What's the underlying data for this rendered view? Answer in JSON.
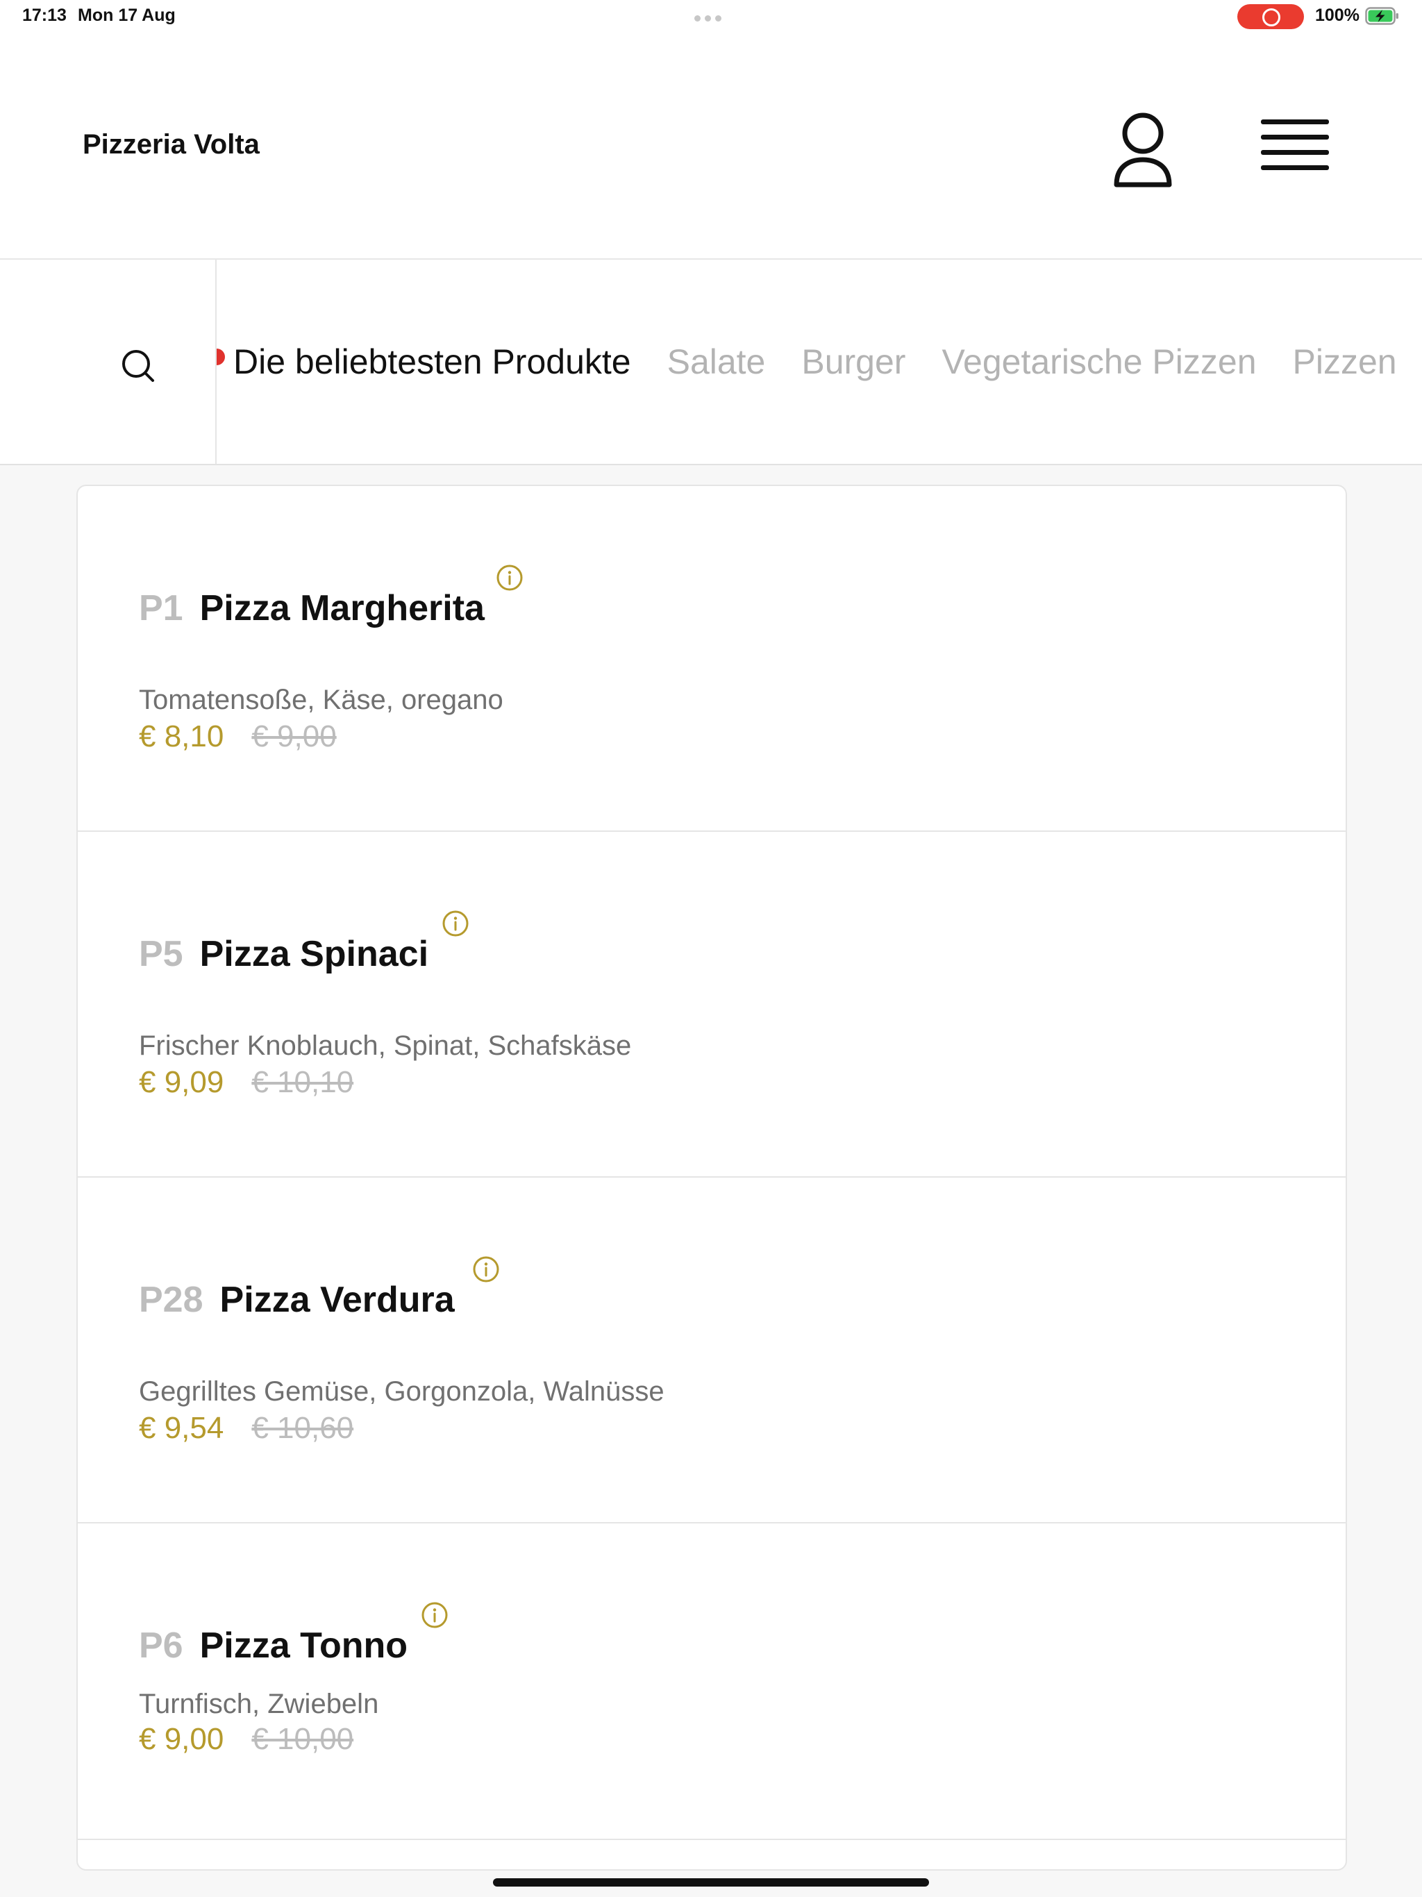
{
  "status_bar": {
    "time": "17:13",
    "date": "Mon 17 Aug",
    "battery_percent": "100%",
    "battery_level": 1.0,
    "recording": true
  },
  "header": {
    "restaurant_name": "Pizzeria Volta",
    "user_icon": "user-profile-icon",
    "menu_icon": "hamburger-menu-icon"
  },
  "categories": {
    "search_icon": "search-icon",
    "items": [
      {
        "label": "Die beliebtesten Produkte",
        "active": true
      },
      {
        "label": "Salate",
        "active": false
      },
      {
        "label": "Burger",
        "active": false
      },
      {
        "label": "Vegetarische Pizzen",
        "active": false
      },
      {
        "label": "Pizzen",
        "active": false
      }
    ]
  },
  "products": [
    {
      "number": "P1",
      "name": "Pizza Margherita",
      "description": "Tomatensoße, Käse, oregano",
      "price": "€ 8,10",
      "old_price": "€ 9,00"
    },
    {
      "number": "P5",
      "name": "Pizza Spinaci",
      "description": "Frischer Knoblauch, Spinat, Schafskäse",
      "price": "€ 9,09",
      "old_price": "€ 10,10"
    },
    {
      "number": "P28",
      "name": "Pizza Verdura",
      "description": "Gegrilltes Gemüse, Gorgonzola, Walnüsse",
      "price": "€ 9,54",
      "old_price": "€ 10,60"
    },
    {
      "number": "P6",
      "name": "Pizza Tonno",
      "description": "Turnfisch, Zwiebeln",
      "price": "€ 9,00",
      "old_price": "€ 10,00"
    }
  ],
  "colors": {
    "accent_gold": "#b59a2d",
    "text_dark": "#111111",
    "text_muted": "#707070",
    "pin_red": "#e0322d",
    "record_red": "#ea3b2f"
  }
}
